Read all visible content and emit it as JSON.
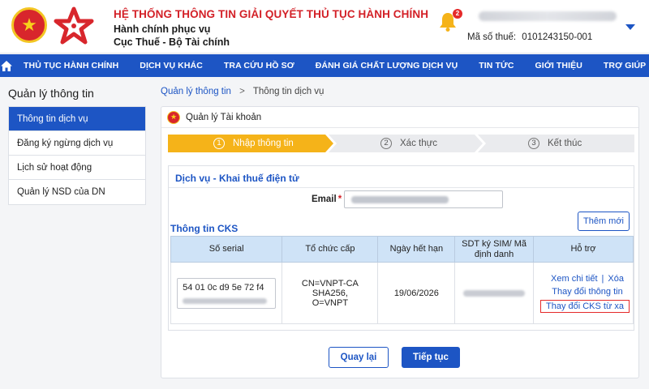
{
  "header": {
    "title": "HỆ THỐNG THÔNG TIN GIẢI QUYẾT THỦ TỤC HÀNH CHÍNH",
    "subtitle1": "Hành chính phục vụ",
    "subtitle2": "Cục Thuế - Bộ Tài chính",
    "notification_count": "2",
    "tax_id_label": "Mã số thuế:",
    "tax_id": "0101243150-001"
  },
  "nav": {
    "items": [
      "THỦ TỤC HÀNH CHÍNH",
      "DỊCH VỤ KHÁC",
      "TRA CỨU HỒ SƠ",
      "ĐÁNH GIÁ CHẤT LƯỢNG DỊCH VỤ",
      "TIN TỨC",
      "GIỚI THIỆU",
      "TRỢ GIÚP"
    ]
  },
  "sidebar": {
    "title": "Quản lý thông tin",
    "items": [
      "Thông tin dịch vụ",
      "Đăng ký ngừng dịch vụ",
      "Lịch sử hoạt động",
      "Quản lý NSD của DN"
    ]
  },
  "breadcrumb": {
    "link": "Quản lý thông tin",
    "separator": ">",
    "current": "Thông tin dịch vụ"
  },
  "card": {
    "title": "Quản lý Tài khoản",
    "steps": [
      {
        "num": "1",
        "label": "Nhập thông tin"
      },
      {
        "num": "2",
        "label": "Xác thực"
      },
      {
        "num": "3",
        "label": "Kết thúc"
      }
    ],
    "service_title": "Dịch vụ - Khai thuế điện tử",
    "email_label": "Email",
    "required_mark": "*",
    "cks_title": "Thông tin CKS",
    "add_button": "Thêm mới",
    "table": {
      "headers": [
        "Số serial",
        "Tổ chức cấp",
        "Ngày hết hạn",
        "SDT ký SIM/ Mã định danh",
        "Hỗ trợ"
      ],
      "row": {
        "serial": "54 01 0c d9 5e 72 f4",
        "issuer_line1": "CN=VNPT-CA SHA256,",
        "issuer_line2": "O=VNPT",
        "expiry": "19/06/2026",
        "support": {
          "view": "Xem chi tiết",
          "separator": "|",
          "delete": "Xóa",
          "change_info": "Thay đổi thông tin",
          "change_remote": "Thay đổi CKS từ xa"
        }
      }
    },
    "back_button": "Quay lại",
    "next_button": "Tiếp tục"
  },
  "colors": {
    "primary": "#1d55c4",
    "brand_red": "#d32027",
    "step_active": "#f5b319",
    "table_header": "#cfe3f7",
    "highlight_border": "#e52a2a"
  }
}
